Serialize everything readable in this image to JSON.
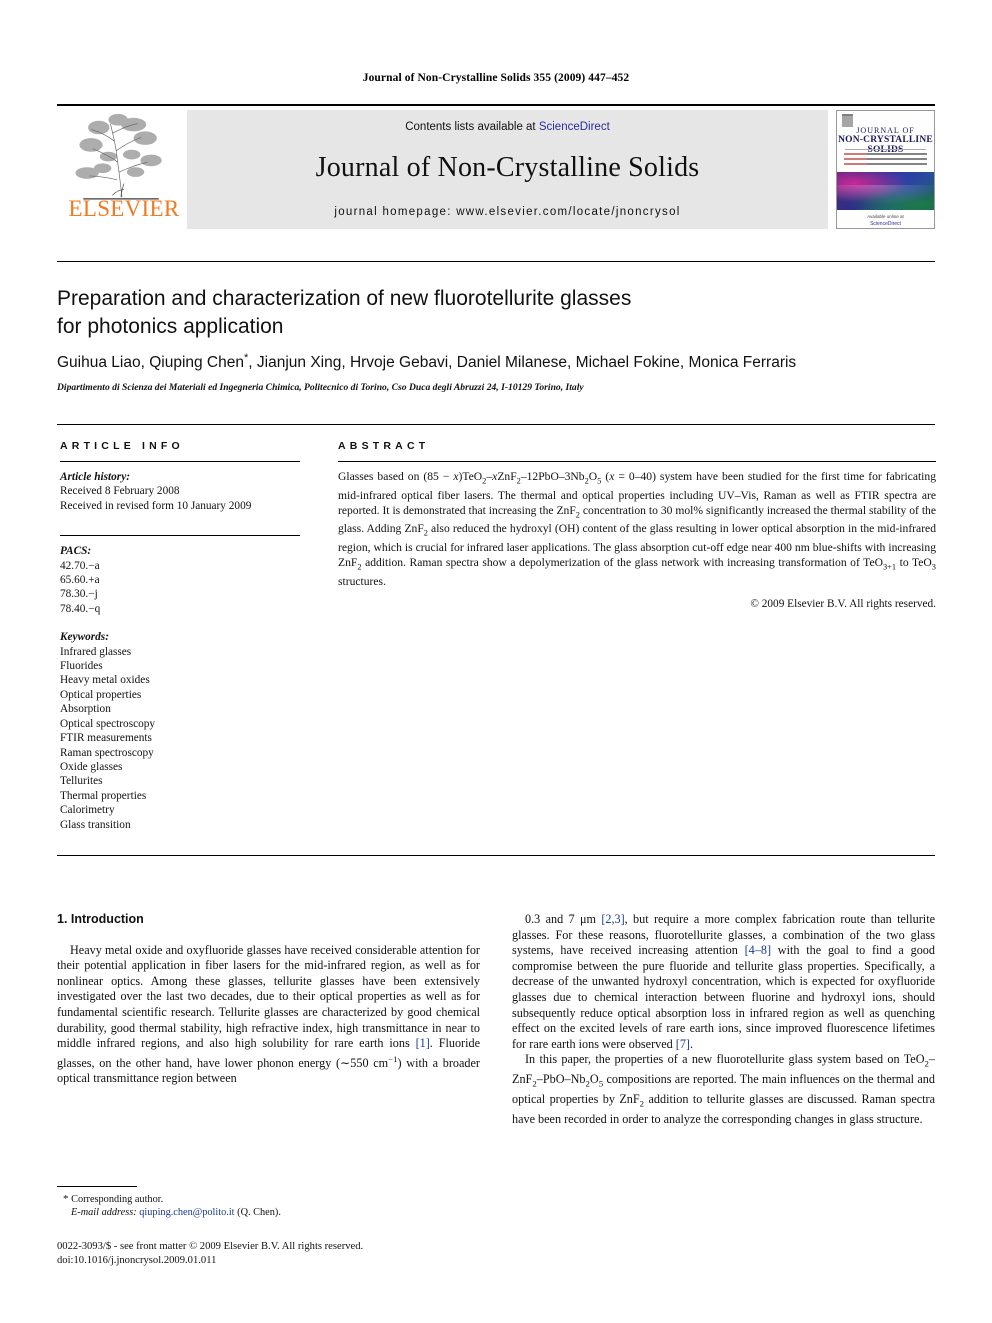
{
  "running_head": "Journal of Non-Crystalline Solids 355 (2009) 447–452",
  "masthead": {
    "publisher": "ELSEVIER",
    "contents_prefix": "Contents lists available at ",
    "contents_link": "ScienceDirect",
    "journal_title": "Journal of Non-Crystalline Solids",
    "homepage": "journal homepage: www.elsevier.com/locate/jnoncrysol",
    "cover": {
      "line1": "JOURNAL OF",
      "line2": "NON-CRYSTALLINE SOLIDS",
      "footer1": "Available online at",
      "footer2": "ScienceDirect"
    }
  },
  "article": {
    "title_line1": "Preparation and characterization of new fluorotellurite glasses",
    "title_line2": "for photonics application",
    "authors": "Guihua Liao, Qiuping Chen, Jianjun Xing, Hrvoje Gebavi, Daniel Milanese, Michael Fokine, Monica Ferraris",
    "author_marker": "*",
    "affiliation": "Dipartimento di Scienza dei Materiali ed Ingegneria Chimica, Politecnico di Torino, Cso Duca degli Abruzzi 24, I-10129 Torino, Italy"
  },
  "article_info": {
    "label": "ARTICLE INFO",
    "history_heading": "Article history:",
    "history_lines": [
      "Received 8 February 2008",
      "Received in revised form 10 January 2009"
    ],
    "pacs_heading": "PACS:",
    "pacs": [
      "42.70.−a",
      "65.60.+a",
      "78.30.−j",
      "78.40.−q"
    ],
    "keywords_heading": "Keywords:",
    "keywords": [
      "Infrared glasses",
      "Fluorides",
      "Heavy metal oxides",
      "Optical properties",
      "Absorption",
      "Optical spectroscopy",
      "FTIR measurements",
      "Raman spectroscopy",
      "Oxide glasses",
      "Tellurites",
      "Thermal properties",
      "Calorimetry",
      "Glass transition"
    ]
  },
  "abstract": {
    "label": "ABSTRACT",
    "text_html": "Glasses based on (85 − <i>x</i>)TeO<sub>2</sub>–<i>x</i>ZnF<sub>2</sub>–12PbO–3Nb<sub>2</sub>O<sub>5</sub> (<i>x</i> = 0–40) system have been studied for the first time for fabricating mid-infrared optical fiber lasers. The thermal and optical properties including UV–Vis, Raman as well as FTIR spectra are reported. It is demonstrated that increasing the ZnF<sub>2</sub> concentration to 30 mol% significantly increased the thermal stability of the glass. Adding ZnF<sub>2</sub> also reduced the hydroxyl (OH) content of the glass resulting in lower optical absorption in the mid-infrared region, which is crucial for infrared laser applications. The glass absorption cut-off edge near 400 nm blue-shifts with increasing ZnF<sub>2</sub> addition. Raman spectra show a depolymerization of the glass network with increasing transformation of TeO<sub>3+1</sub> to TeO<sub>3</sub> structures.",
    "copyright": "© 2009 Elsevier B.V. All rights reserved."
  },
  "body": {
    "section_heading": "1. Introduction",
    "left_paragraphs_html": [
      "Heavy metal oxide and oxyfluoride glasses have received considerable attention for their potential application in fiber lasers for the mid-infrared region, as well as for nonlinear optics. Among these glasses, tellurite glasses have been extensively investigated over the last two decades, due to their optical properties as well as for fundamental scientific research. Tellurite glasses are characterized by good chemical durability, good thermal stability, high refractive index, high transmittance in near to middle infrared regions, and also high solubility for rare earth ions <span class=\"ref\">[1]</span>. Fluoride glasses, on the other hand, have lower phonon energy (∼550 cm<sup>−1</sup>) with a broader optical transmittance region between"
    ],
    "right_paragraphs_html": [
      "0.3 and 7 μm <span class=\"ref\">[2,3]</span>, but require a more complex fabrication route than tellurite glasses. For these reasons, fluorotellurite glasses, a combination of the two glass systems, have received increasing attention <span class=\"ref\">[4–8]</span> with the goal to find a good compromise between the pure fluoride and tellurite glass properties. Specifically, a decrease of the unwanted hydroxyl concentration, which is expected for oxyfluoride glasses due to chemical interaction between fluorine and hydroxyl ions, should subsequently reduce optical absorption loss in infrared region as well as quenching effect on the excited levels of rare earth ions, since improved fluorescence lifetimes for rare earth ions were observed <span class=\"ref\">[7]</span>.",
      "In this paper, the properties of a new fluorotellurite glass system based on TeO<sub>2</sub>–ZnF<sub>2</sub>–PbO–Nb<sub>2</sub>O<sub>5</sub> compositions are reported. The main influences on the thermal and optical properties by ZnF<sub>2</sub> addition to tellurite glasses are discussed. Raman spectra have been recorded in order to analyze the corresponding changes in glass structure."
    ]
  },
  "footnote": {
    "corresponding_marker": "*",
    "corresponding_text": "Corresponding author.",
    "email_label": "E-mail address:",
    "email": "qiuping.chen@polito.it",
    "email_owner": "(Q. Chen)."
  },
  "imprint": {
    "line1": "0022-3093/$ - see front matter © 2009 Elsevier B.V. All rights reserved.",
    "line2": "doi:10.1016/j.jnoncrysol.2009.01.011"
  },
  "colors": {
    "elsevier_orange": "#ee7b21",
    "link_blue": "#2b2b9c",
    "reference_blue": "#1a3a8f",
    "band_gray": "#e6e6e6"
  }
}
